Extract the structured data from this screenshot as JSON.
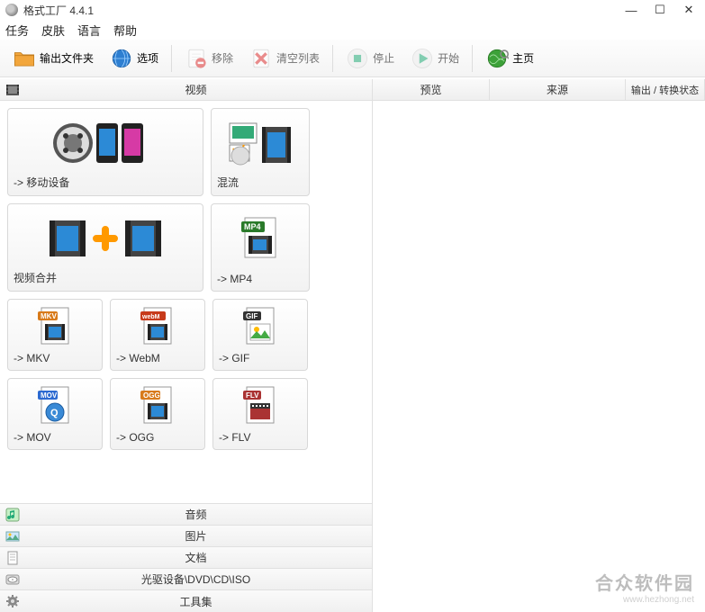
{
  "window": {
    "title": "格式工厂 4.4.1"
  },
  "menu": {
    "task": "任务",
    "skin": "皮肤",
    "language": "语言",
    "help": "帮助"
  },
  "toolbar": {
    "output_folder": "输出文件夹",
    "options": "选项",
    "remove": "移除",
    "clear_list": "清空列表",
    "stop": "停止",
    "start": "开始",
    "home": "主页"
  },
  "categories": {
    "video": "视频",
    "audio": "音频",
    "picture": "图片",
    "document": "文档",
    "optical": "光驱设备\\DVD\\CD\\ISO",
    "toolset": "工具集"
  },
  "video_tiles": {
    "mobile": "-> 移动设备",
    "mux": "混流",
    "merge": "视频合并",
    "mp4": "-> MP4",
    "mkv": "-> MKV",
    "webm": "-> WebM",
    "gif": "-> GIF",
    "mov": "-> MOV",
    "ogg": "-> OGG",
    "flv": "-> FLV"
  },
  "right_headers": {
    "preview": "预览",
    "source": "来源",
    "status": "输出 / 转换状态"
  },
  "watermark": {
    "line1": "合众软件园",
    "line2": "www.hezhong.net"
  }
}
